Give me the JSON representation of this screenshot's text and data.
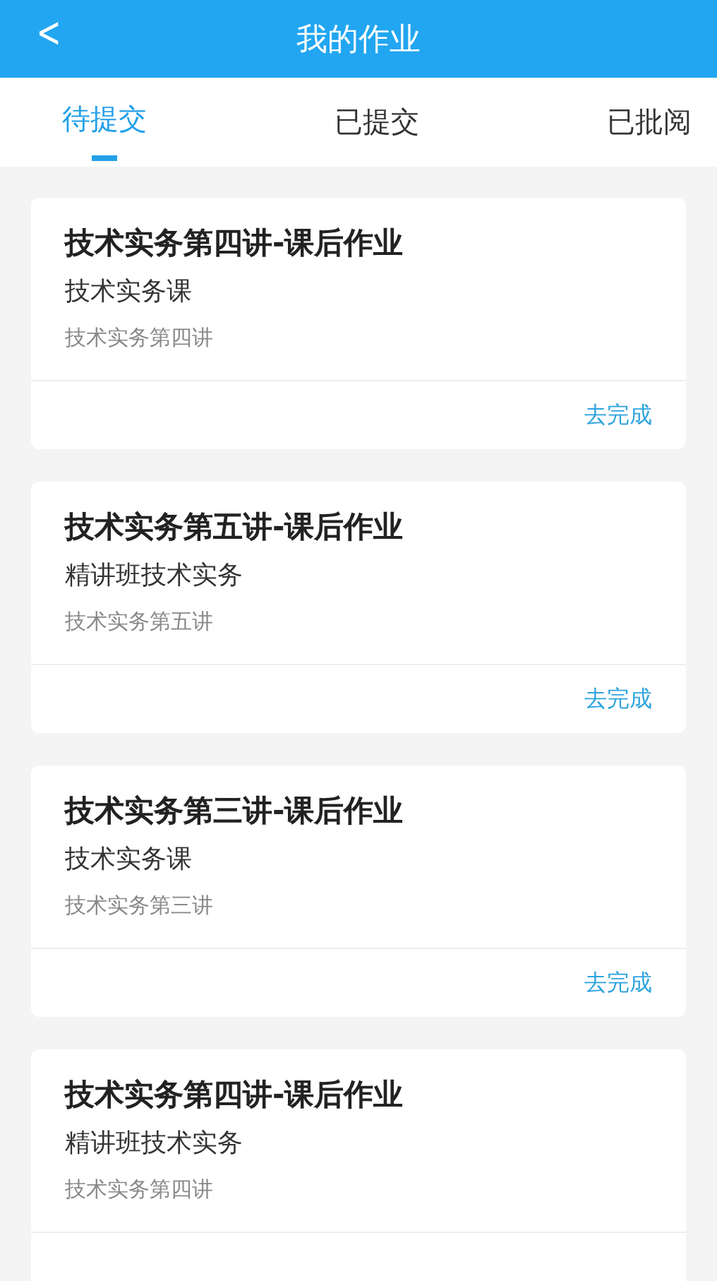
{
  "header": {
    "back": "<",
    "title": "我的作业"
  },
  "tabs": [
    {
      "label": "待提交",
      "selected": true
    },
    {
      "label": "已提交",
      "selected": false
    },
    {
      "label": "已批阅",
      "selected": false
    }
  ],
  "cards": [
    {
      "title": "技术实务第四讲-课后作业",
      "course": "技术实务课",
      "lesson": "技术实务第四讲",
      "action": "去完成"
    },
    {
      "title": "技术实务第五讲-课后作业",
      "course": "精讲班技术实务",
      "lesson": "技术实务第五讲",
      "action": "去完成"
    },
    {
      "title": "技术实务第三讲-课后作业",
      "course": "技术实务课",
      "lesson": "技术实务第三讲",
      "action": "去完成"
    },
    {
      "title": "技术实务第四讲-课后作业",
      "course": "精讲班技术实务",
      "lesson": "技术实务第四讲"
    }
  ]
}
